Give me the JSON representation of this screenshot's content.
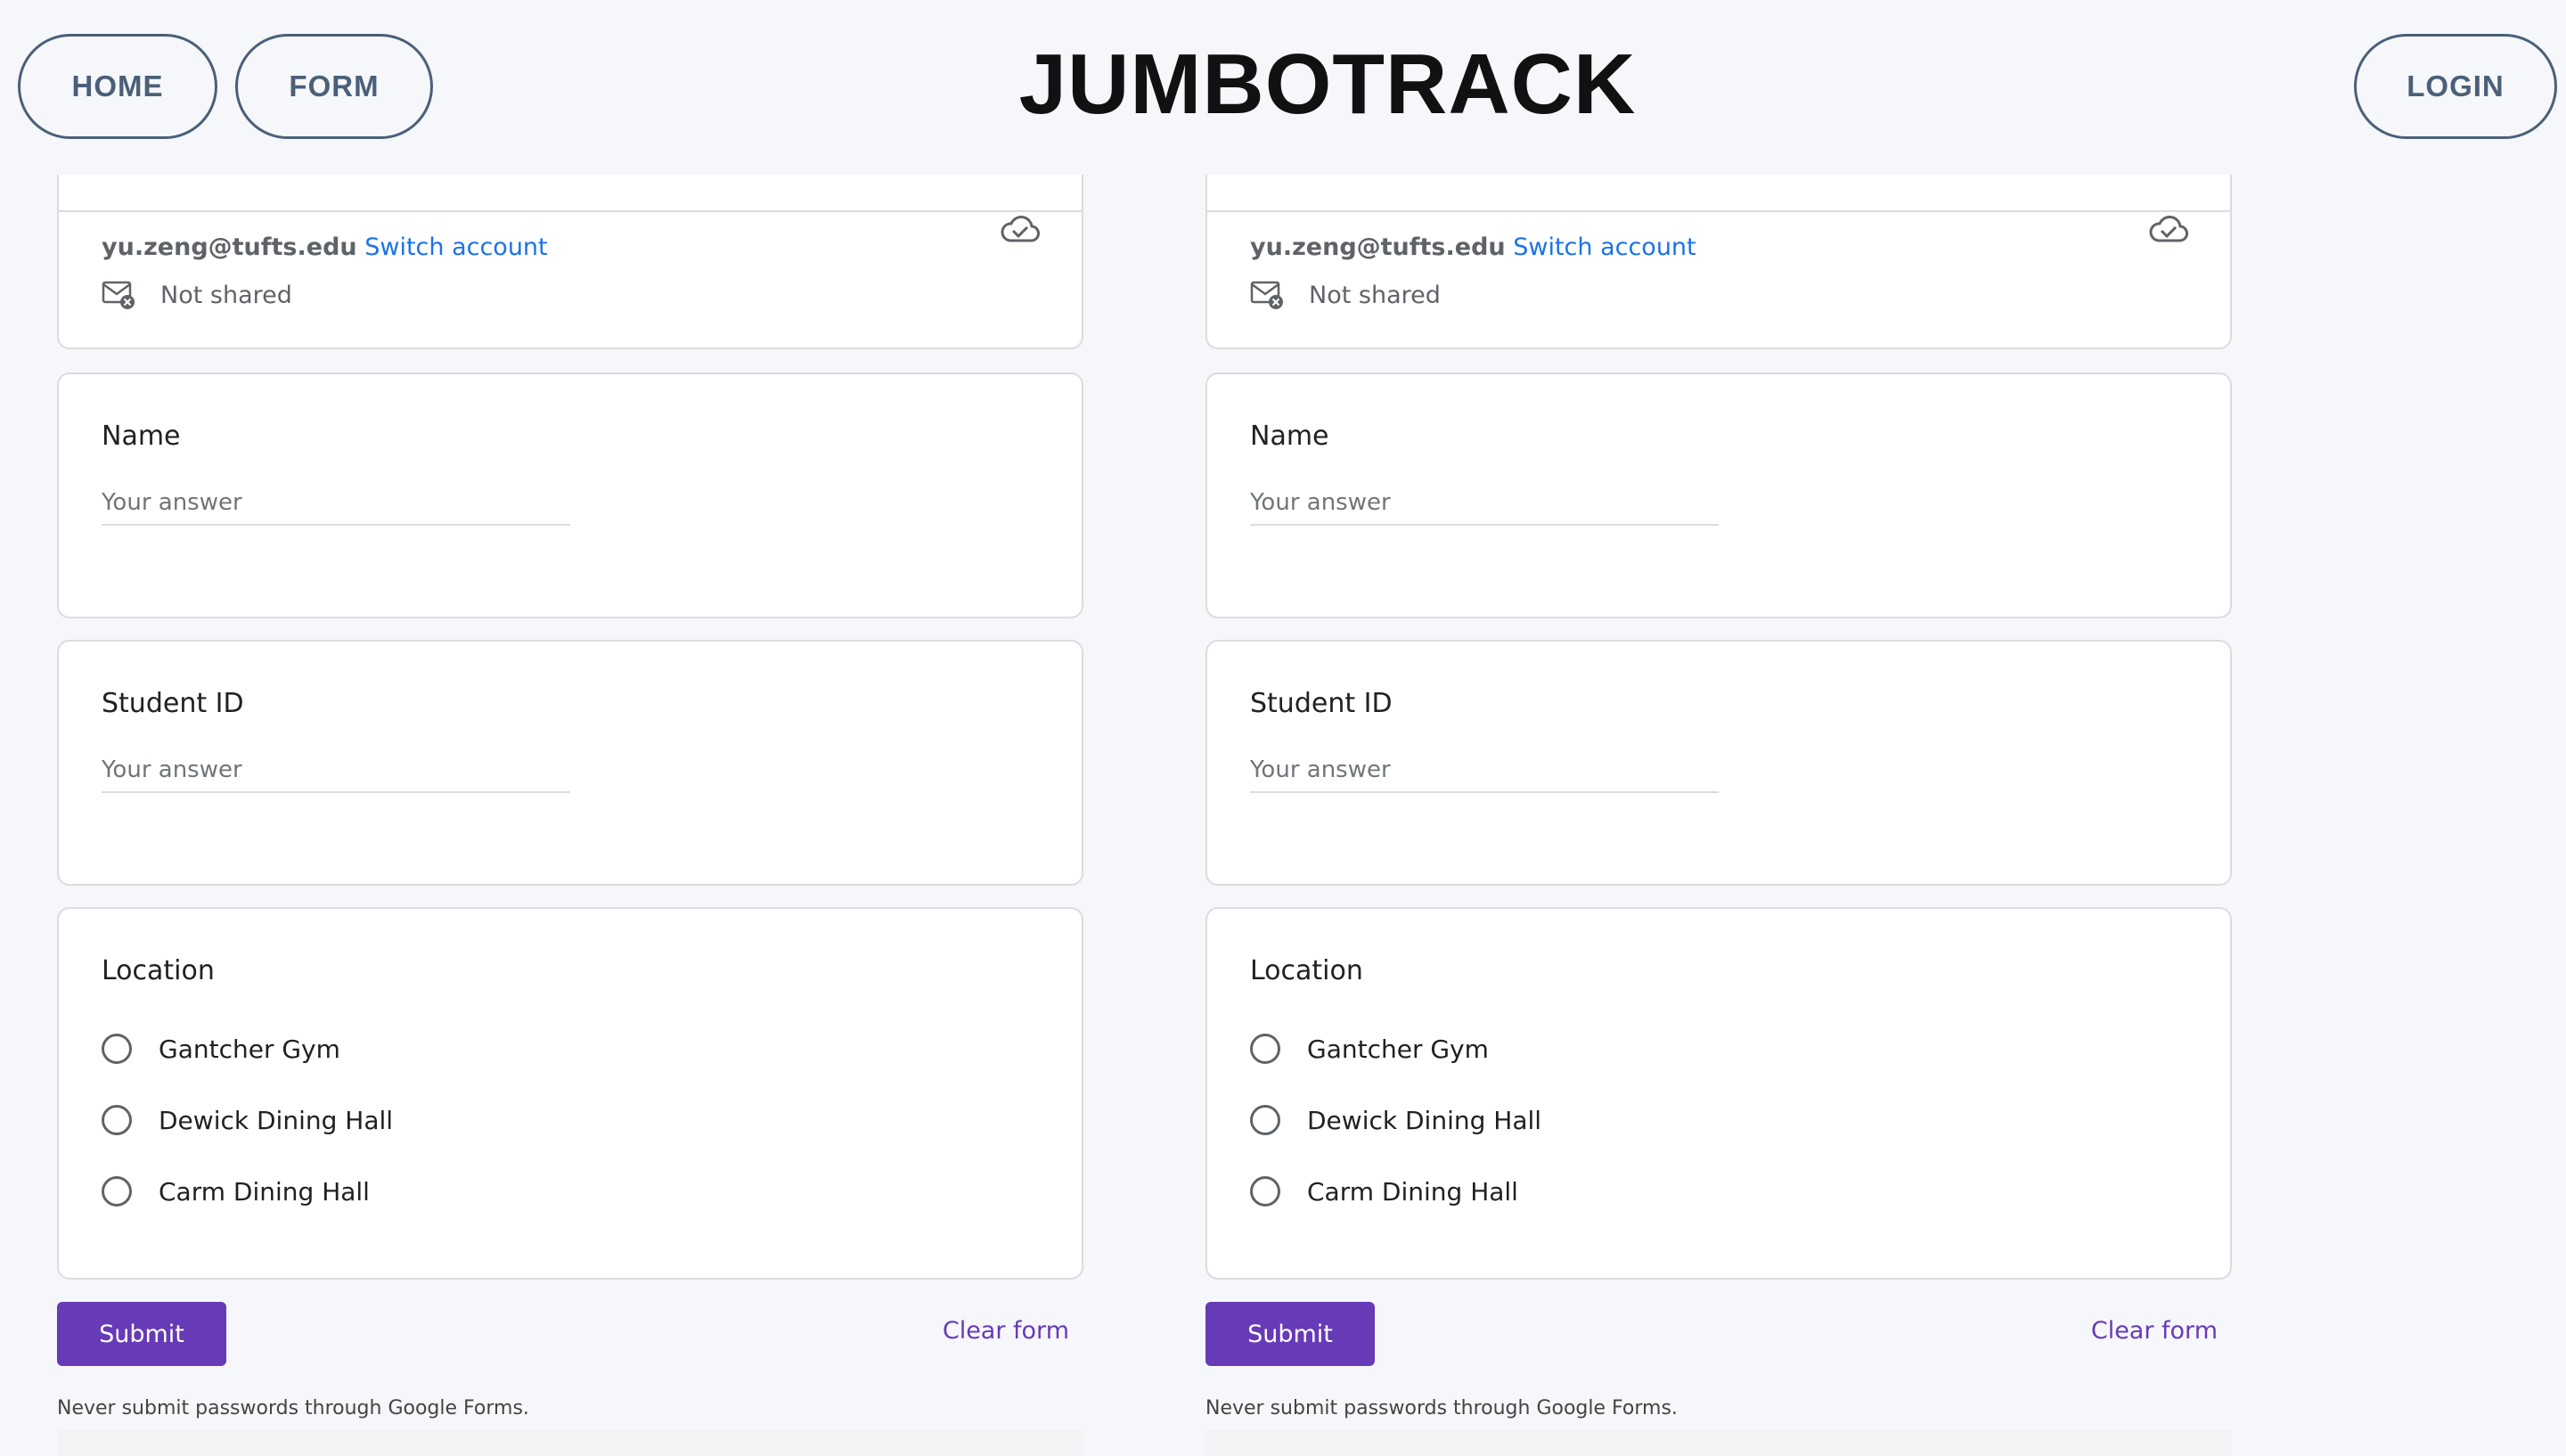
{
  "header": {
    "nav": {
      "home": "HOME",
      "form": "FORM",
      "login": "LOGIN"
    },
    "title": "JUMBOTRACK"
  },
  "forms": [
    {
      "account": {
        "email": "yu.zeng@tufts.edu",
        "switch": "Switch account",
        "shared": "Not shared"
      },
      "name": {
        "label": "Name",
        "placeholder": "Your answer"
      },
      "student_id": {
        "label": "Student ID",
        "placeholder": "Your answer"
      },
      "location": {
        "label": "Location",
        "options": [
          "Gantcher Gym",
          "Dewick Dining Hall",
          "Carm Dining Hall"
        ]
      },
      "submit": "Submit",
      "clear": "Clear form",
      "warning": "Never submit passwords through Google Forms."
    },
    {
      "account": {
        "email": "yu.zeng@tufts.edu",
        "switch": "Switch account",
        "shared": "Not shared"
      },
      "name": {
        "label": "Name",
        "placeholder": "Your answer"
      },
      "student_id": {
        "label": "Student ID",
        "placeholder": "Your answer"
      },
      "location": {
        "label": "Location",
        "options": [
          "Gantcher Gym",
          "Dewick Dining Hall",
          "Carm Dining Hall"
        ]
      },
      "submit": "Submit",
      "clear": "Clear form",
      "warning": "Never submit passwords through Google Forms."
    }
  ],
  "colors": {
    "accent": "#673ab7",
    "link": "#1a73e8",
    "nav": "#4a6079",
    "background": "#f6f7fa"
  },
  "icons": {
    "mail": "mail-not-shared-icon",
    "cloud": "cloud-saved-icon",
    "radio": "radio-unchecked-icon"
  }
}
